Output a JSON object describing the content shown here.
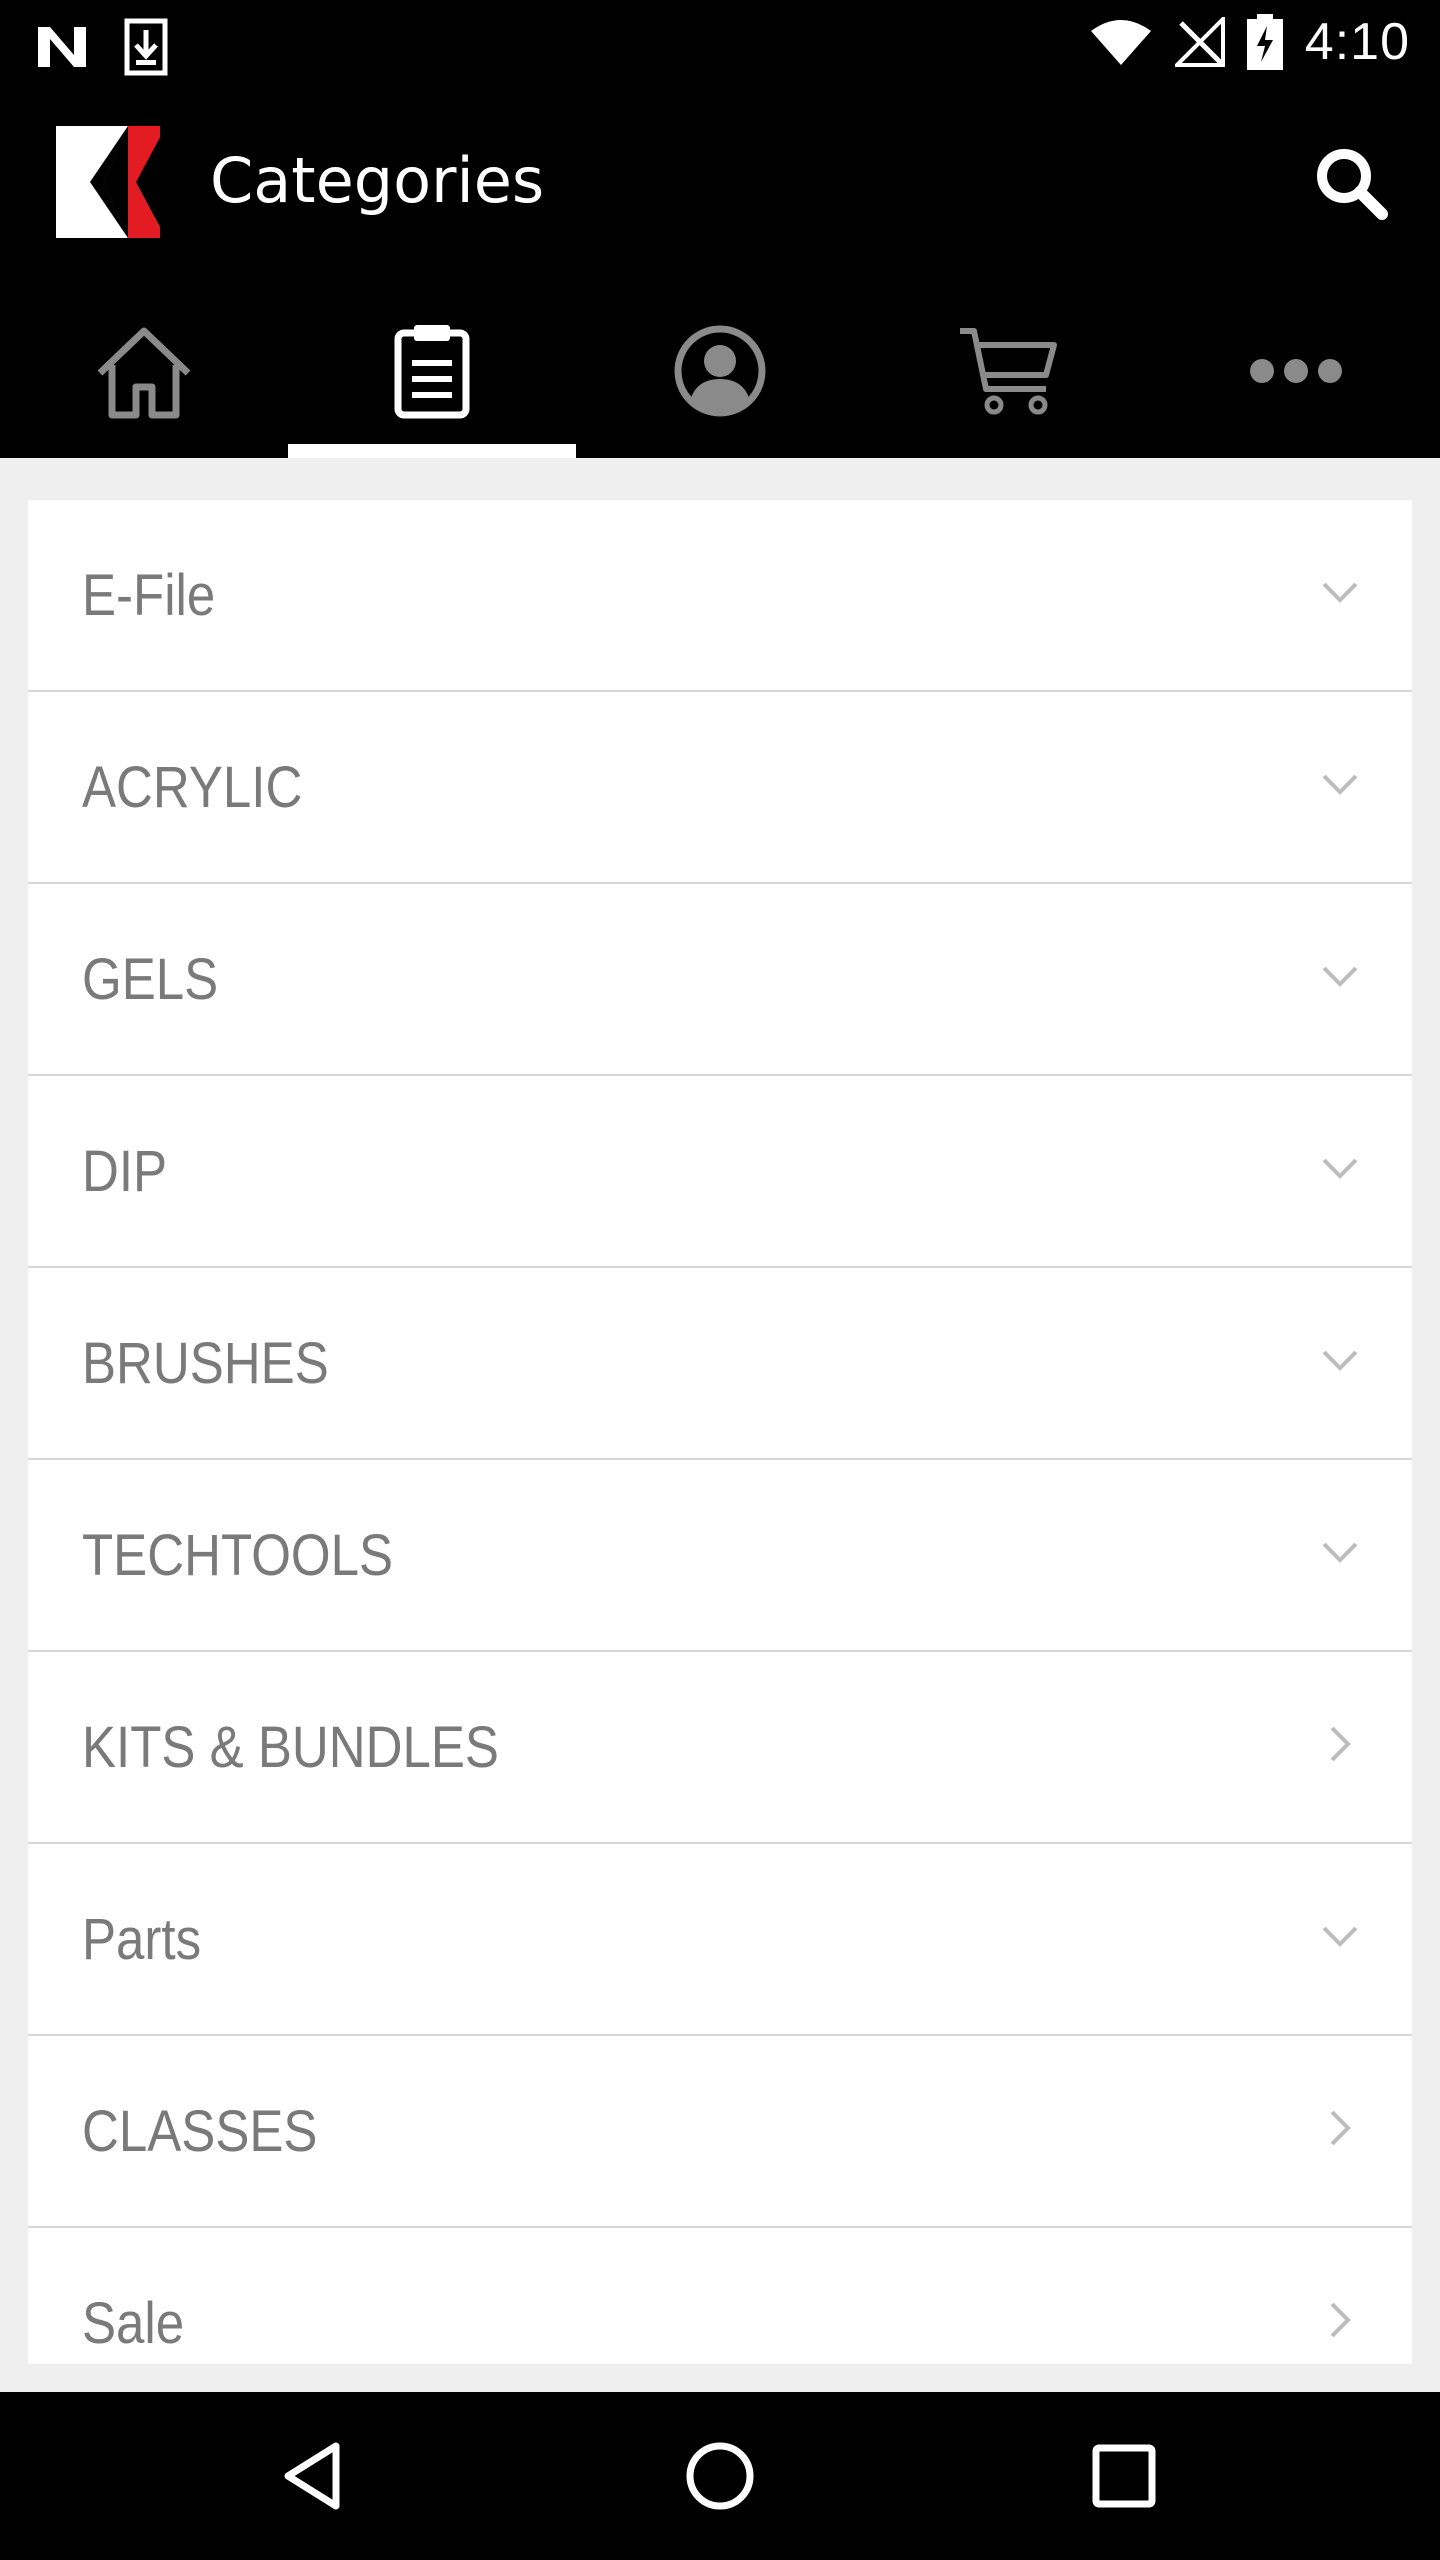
{
  "status_bar": {
    "time": "4:10",
    "icons": [
      "n-logo-icon",
      "download-icon",
      "wifi-icon",
      "no-signal-icon",
      "battery-charging-icon"
    ]
  },
  "app_bar": {
    "title": "Categories",
    "logo": "brand-logo",
    "search_icon": "search-icon"
  },
  "tabs": [
    {
      "name": "home",
      "icon": "home-icon",
      "selected": false
    },
    {
      "name": "categories",
      "icon": "clipboard-list-icon",
      "selected": true
    },
    {
      "name": "account",
      "icon": "user-circle-icon",
      "selected": false
    },
    {
      "name": "cart",
      "icon": "cart-icon",
      "selected": false
    },
    {
      "name": "more",
      "icon": "more-dots-icon",
      "selected": false
    }
  ],
  "categories": [
    {
      "label": "E-File",
      "indicator": "chevron-down"
    },
    {
      "label": "ACRYLIC",
      "indicator": "chevron-down"
    },
    {
      "label": "GELS",
      "indicator": "chevron-down"
    },
    {
      "label": "DIP",
      "indicator": "chevron-down"
    },
    {
      "label": "BRUSHES",
      "indicator": "chevron-down"
    },
    {
      "label": "TECHTOOLS",
      "indicator": "chevron-down"
    },
    {
      "label": "KITS & BUNDLES",
      "indicator": "chevron-right"
    },
    {
      "label": "Parts",
      "indicator": "chevron-down"
    },
    {
      "label": "CLASSES",
      "indicator": "chevron-right"
    },
    {
      "label": "Sale",
      "indicator": "chevron-right"
    }
  ],
  "colors": {
    "bar_background": "#000000",
    "page_background": "#efefef",
    "card_background": "#ffffff",
    "label_text": "#7a7a7a",
    "divider": "#d6d6d6",
    "logo_red": "#e31b23",
    "chevron": "#bdbdbd"
  },
  "nav_bar": {
    "buttons": [
      "back-icon",
      "home-circle-icon",
      "recents-square-icon"
    ]
  }
}
